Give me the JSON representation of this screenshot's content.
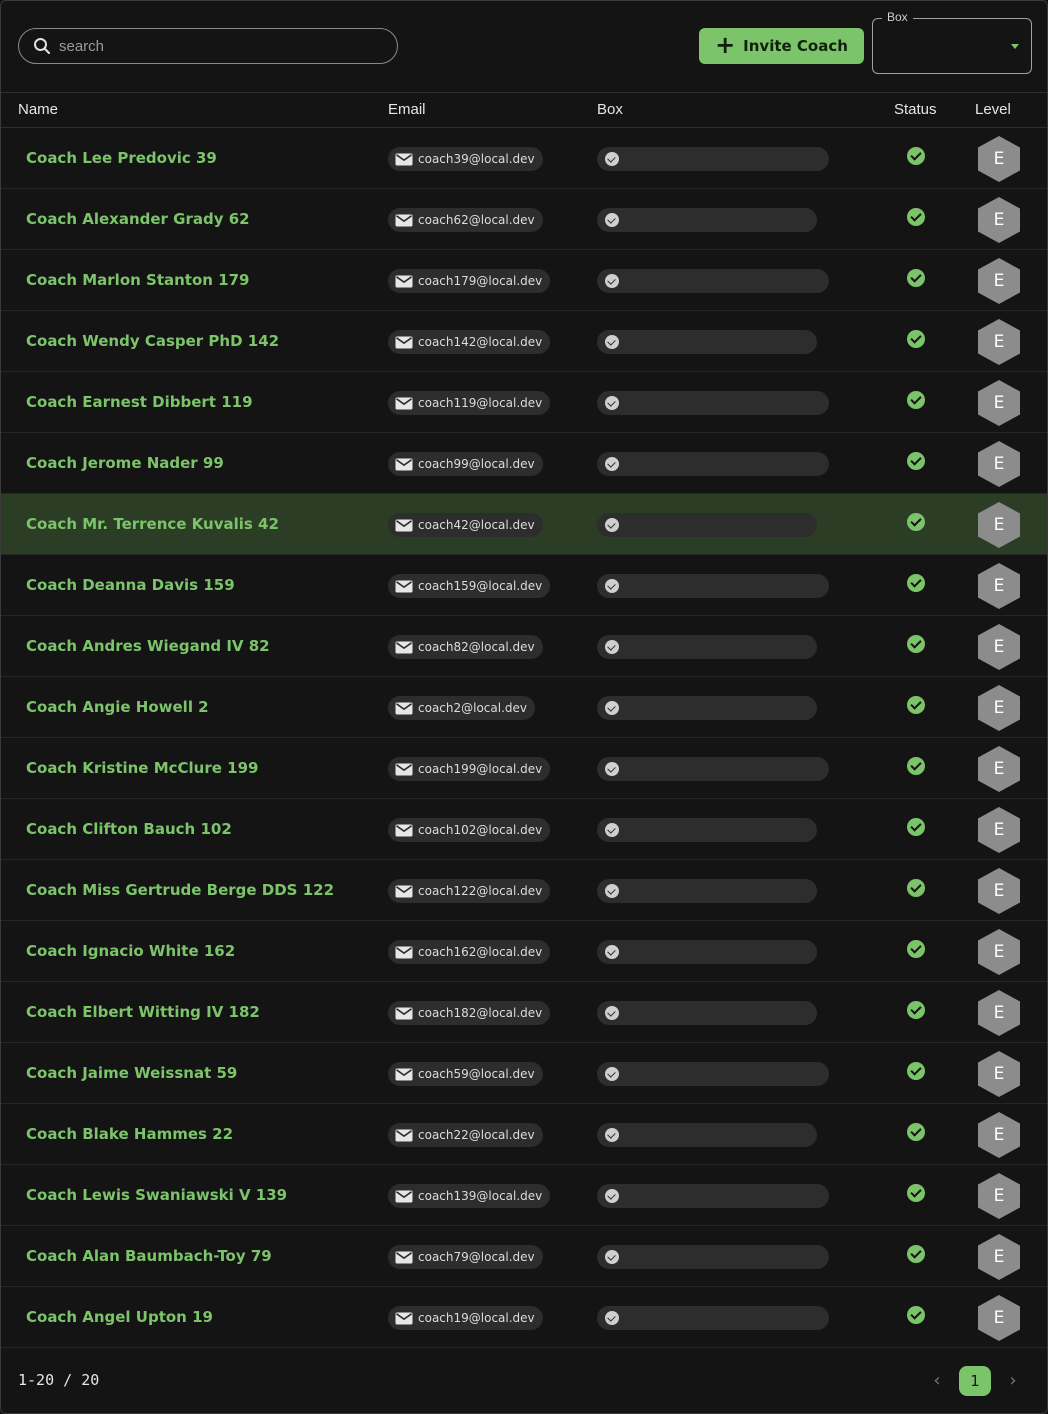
{
  "search": {
    "placeholder": "search"
  },
  "toolbar": {
    "invite_label": "Invite Coach",
    "box_label": "Box"
  },
  "columns": {
    "name": "Name",
    "email": "Email",
    "box": "Box",
    "status": "Status",
    "level": "Level"
  },
  "level_glyph": "E",
  "accent_color": "#7cc46a",
  "highlight_row": 6,
  "rows": [
    {
      "name": "Coach Lee Predovic 39",
      "email": "coach39@local.dev"
    },
    {
      "name": "Coach Alexander Grady 62",
      "email": "coach62@local.dev"
    },
    {
      "name": "Coach Marlon Stanton 179",
      "email": "coach179@local.dev"
    },
    {
      "name": "Coach Wendy Casper PhD 142",
      "email": "coach142@local.dev"
    },
    {
      "name": "Coach Earnest Dibbert 119",
      "email": "coach119@local.dev"
    },
    {
      "name": "Coach Jerome Nader 99",
      "email": "coach99@local.dev"
    },
    {
      "name": "Coach Mr. Terrence Kuvalis 42",
      "email": "coach42@local.dev"
    },
    {
      "name": "Coach Deanna Davis 159",
      "email": "coach159@local.dev"
    },
    {
      "name": "Coach Andres Wiegand IV 82",
      "email": "coach82@local.dev"
    },
    {
      "name": "Coach Angie Howell 2",
      "email": "coach2@local.dev"
    },
    {
      "name": "Coach Kristine McClure 199",
      "email": "coach199@local.dev"
    },
    {
      "name": "Coach Clifton Bauch 102",
      "email": "coach102@local.dev"
    },
    {
      "name": "Coach Miss Gertrude Berge DDS 122",
      "email": "coach122@local.dev"
    },
    {
      "name": "Coach Ignacio White 162",
      "email": "coach162@local.dev"
    },
    {
      "name": "Coach Elbert Witting IV 182",
      "email": "coach182@local.dev"
    },
    {
      "name": "Coach Jaime Weissnat 59",
      "email": "coach59@local.dev"
    },
    {
      "name": "Coach Blake Hammes 22",
      "email": "coach22@local.dev"
    },
    {
      "name": "Coach Lewis Swaniawski V 139",
      "email": "coach139@local.dev"
    },
    {
      "name": "Coach Alan Baumbach-Toy 79",
      "email": "coach79@local.dev"
    },
    {
      "name": "Coach Angel Upton 19",
      "email": "coach19@local.dev"
    }
  ],
  "footer": {
    "range": "1-20 / 20",
    "current_page": "1",
    "prev_icon": "chevron-left-icon",
    "next_icon": "chevron-right-icon"
  }
}
